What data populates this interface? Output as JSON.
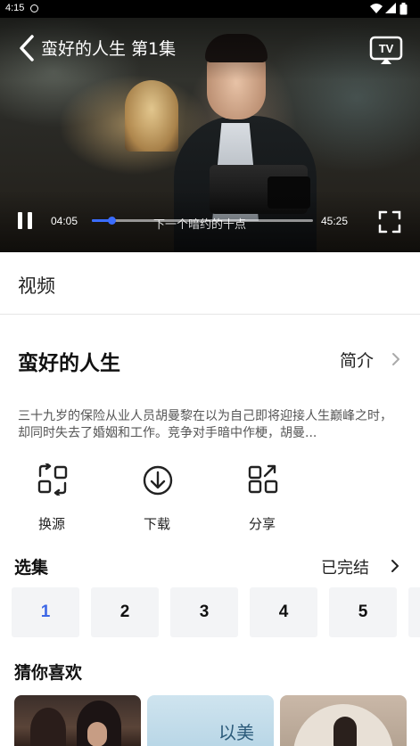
{
  "status_bar": {
    "time": "4:15"
  },
  "player": {
    "title": "蛮好的人生 第1集",
    "current_time": "04:05",
    "total_time": "45:25",
    "subtitle": "下一个暗约的十点",
    "progress": 0.09,
    "tv_label": "TV",
    "accent": "#3a6cff"
  },
  "tabs": {
    "video": "视频"
  },
  "show": {
    "title": "蛮好的人生",
    "intro_label": "简介",
    "description": "三十九岁的保险从业人员胡曼黎在以为自己即将迎接人生巅峰之时，却同时失去了婚姻和工作。竞争对手暗中作梗，胡曼..."
  },
  "actions": [
    {
      "label": "换源",
      "icon": "swap-source-icon"
    },
    {
      "label": "下载",
      "icon": "download-icon"
    },
    {
      "label": "分享",
      "icon": "share-icon"
    }
  ],
  "episodes": {
    "heading": "选集",
    "status": "已完结",
    "items": [
      "1",
      "2",
      "3",
      "4",
      "5"
    ],
    "active": "1",
    "active_color": "#3d67e6"
  },
  "recommend": {
    "heading": "猜你喜欢",
    "poster_2_text": "以美"
  }
}
